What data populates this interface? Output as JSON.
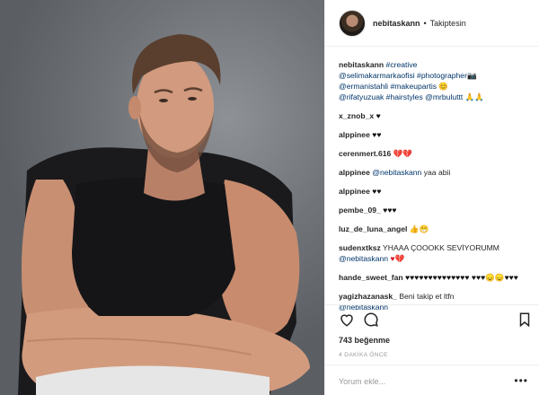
{
  "header": {
    "username": "nebitaskann",
    "separator": "•",
    "follow_status": "Takiptesin"
  },
  "caption": {
    "username": "nebitaskann",
    "line1": "#creative",
    "line2a": "@selimakarmarkaofisi",
    "line2b": "#photographer",
    "line3a": "@ermanistahli",
    "line3b": "#makeupartis",
    "line4a": "@rifatyuzuak",
    "line4b": "#hairstyles",
    "line4c": "@mrbuluttt"
  },
  "comments": [
    {
      "user": "x_znob_x",
      "text": "♥"
    },
    {
      "user": "alppinee",
      "text": "♥♥"
    },
    {
      "user": "cerenmert.616",
      "text": "💔💔"
    },
    {
      "user": "alppinee",
      "mention": "@nebitaskann",
      "text": "yaa abii"
    },
    {
      "user": "alppinee",
      "text": "♥♥"
    },
    {
      "user": "pembe_09_",
      "text": "♥♥♥"
    },
    {
      "user": "luz_de_luna_angel",
      "text": "👍😁"
    },
    {
      "user": "sudenxtksz",
      "text": "YHAAA ÇOOOKK SEVİYORUMM",
      "mention": "@nebitaskann",
      "text2": "♥💔"
    },
    {
      "user": "hande_sweet_fan",
      "text": "♥♥♥♥♥♥♥♥♥♥♥♥♥♥ ♥♥♥😞😞♥♥♥"
    },
    {
      "user": "yagizhazanask_",
      "text": "Beni takip et ltfn",
      "mention": "@nebitaskann"
    }
  ],
  "likes": "743 beğenme",
  "timestamp": "4 DAKİKA ÖNCE",
  "comment_placeholder": "Yorum ekle...",
  "more_label": "•••",
  "icons": {
    "like": "heart-icon",
    "comment": "comment-icon",
    "save": "bookmark-icon"
  }
}
